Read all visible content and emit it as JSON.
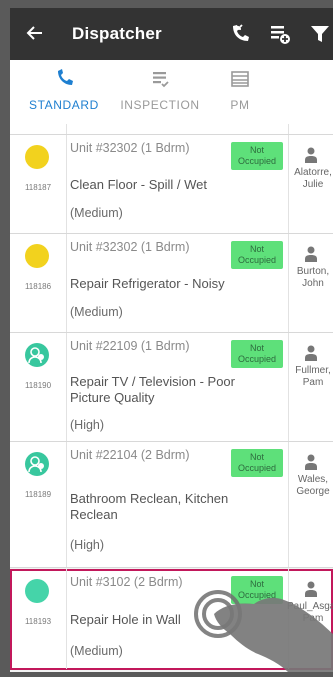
{
  "header": {
    "title": "Dispatcher",
    "back_icon": "back-arrow-icon",
    "icons": [
      "phone-callback-icon",
      "checklist-icon",
      "filter-icon"
    ]
  },
  "tabs": [
    {
      "label": "STANDARD",
      "icon": "phone-icon",
      "active": true
    },
    {
      "label": "INSPECTION",
      "icon": "checklist-icon",
      "active": false
    },
    {
      "label": "PM",
      "icon": "list-icon",
      "active": false
    }
  ],
  "colors": {
    "appbar": "#333333",
    "active_tab": "#1e7fd0",
    "status_yellow": "#f2d21e",
    "status_teal": "#38c79e",
    "status_mint": "#45d4a9",
    "occupied_badge": "#5ee07a",
    "selected_outline": "#c2185b"
  },
  "work_orders": [
    {
      "id": "118187",
      "unit": "Unit #32302 (1 Bdrm)",
      "status": "Not Occupied",
      "description": "Clean Floor - Spill / Wet",
      "priority": "(Medium)",
      "assignee": "Alatorre, Julie",
      "icon": "yellow-dot"
    },
    {
      "id": "118186",
      "unit": "Unit #32302 (1 Bdrm)",
      "status": "Not Occupied",
      "description": "Repair Refrigerator - Noisy",
      "priority": "(Medium)",
      "assignee": "Burton, John",
      "icon": "yellow-dot"
    },
    {
      "id": "118190",
      "unit": "Unit #22109 (1 Bdrm)",
      "status": "Not Occupied",
      "description": "Repair TV / Television - Poor Picture Quality",
      "priority": "(High)",
      "assignee": "Fullmer, Pam",
      "icon": "resident-icon"
    },
    {
      "id": "118189",
      "unit": "Unit #22104 (2 Bdrm)",
      "status": "Not Occupied",
      "description": "Bathroom Reclean, Kitchen Reclean",
      "priority": "(High)",
      "assignee": "Wales, George",
      "icon": "resident-icon"
    },
    {
      "id": "118193",
      "unit": "Unit #3102 (2 Bdrm)",
      "status": "Not Occupied",
      "description": "Repair Hole in Wall",
      "priority": "(Medium)",
      "assignee": "Paul_Asgard, Pam",
      "icon": "mint-dot"
    }
  ]
}
